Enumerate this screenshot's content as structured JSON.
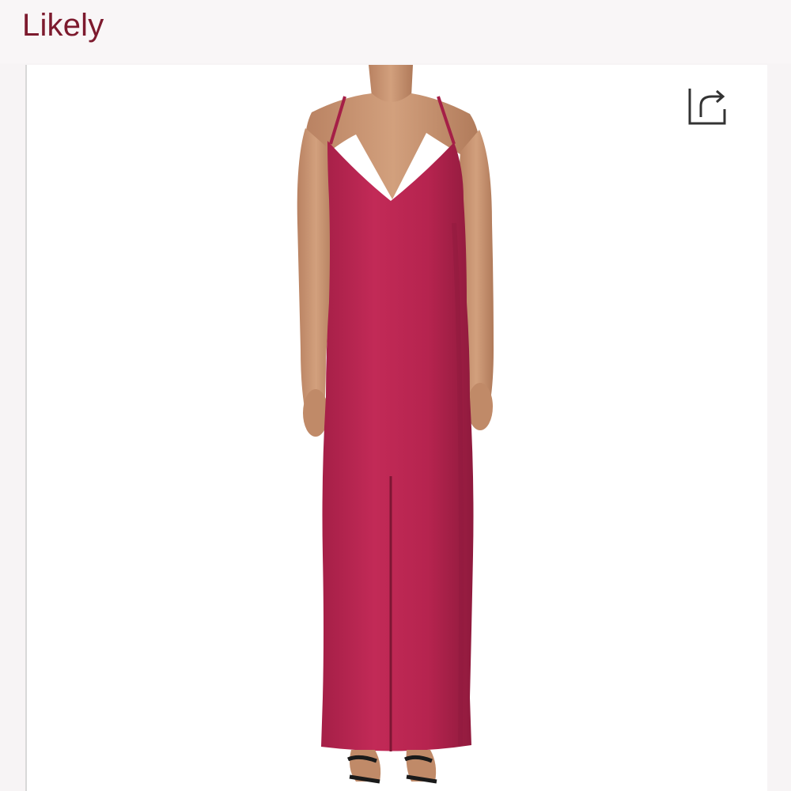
{
  "header": {
    "brand": "Likely"
  },
  "product_image": {
    "description_icon": "model-wearing-dress",
    "dress_color": "#b5244f",
    "skin_color": "#c7936f"
  },
  "actions": {
    "share_icon": "share-icon"
  }
}
